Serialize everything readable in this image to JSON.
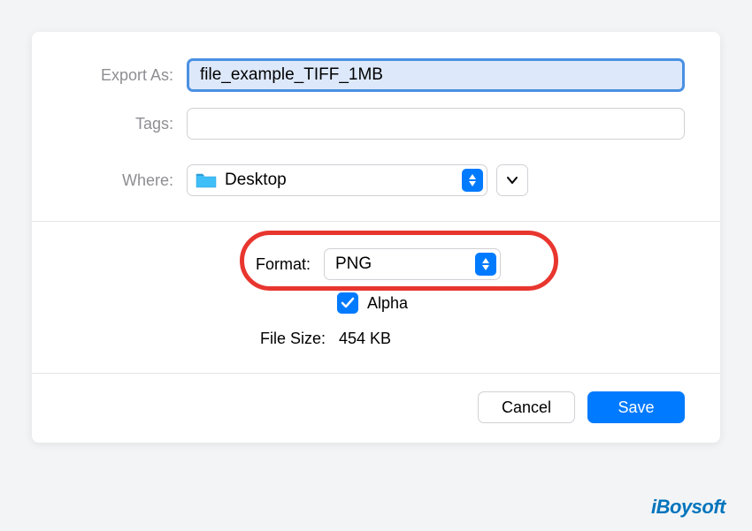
{
  "form": {
    "exportAs": {
      "label": "Export As:",
      "value": "file_example_TIFF_1MB"
    },
    "tags": {
      "label": "Tags:",
      "value": ""
    },
    "where": {
      "label": "Where:",
      "value": "Desktop"
    }
  },
  "format": {
    "label": "Format:",
    "value": "PNG",
    "alpha": {
      "label": "Alpha",
      "checked": true
    },
    "fileSize": {
      "label": "File Size:",
      "value": "454 KB"
    }
  },
  "buttons": {
    "cancel": "Cancel",
    "save": "Save"
  },
  "watermark": "iBoysoft"
}
